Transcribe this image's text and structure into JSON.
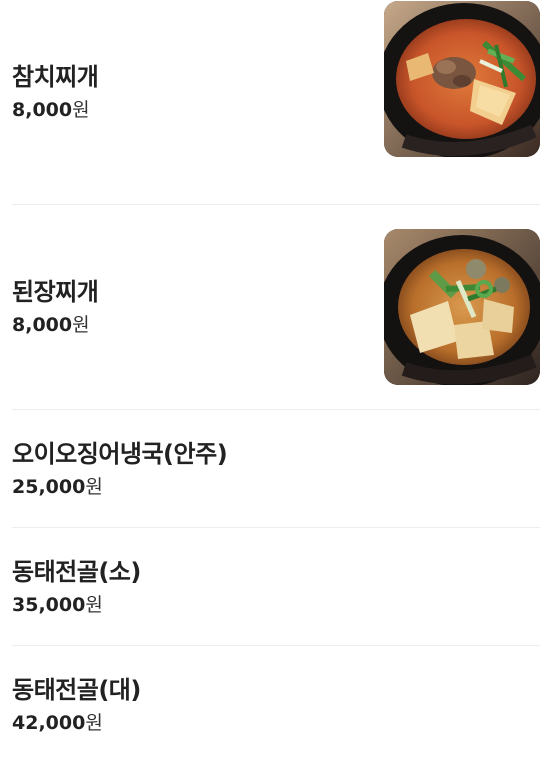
{
  "menu": {
    "items": [
      {
        "name": "참치찌개",
        "price": "8,000",
        "unit": "원",
        "photo": "kimchi-tuna-stew-photo"
      },
      {
        "name": "된장찌개",
        "price": "8,000",
        "unit": "원",
        "photo": "soybean-paste-stew-photo"
      },
      {
        "name": "오이오징어냉국(안주)",
        "price": "25,000",
        "unit": "원"
      },
      {
        "name": "동태전골(소)",
        "price": "35,000",
        "unit": "원"
      },
      {
        "name": "동태전골(대)",
        "price": "42,000",
        "unit": "원"
      }
    ]
  }
}
